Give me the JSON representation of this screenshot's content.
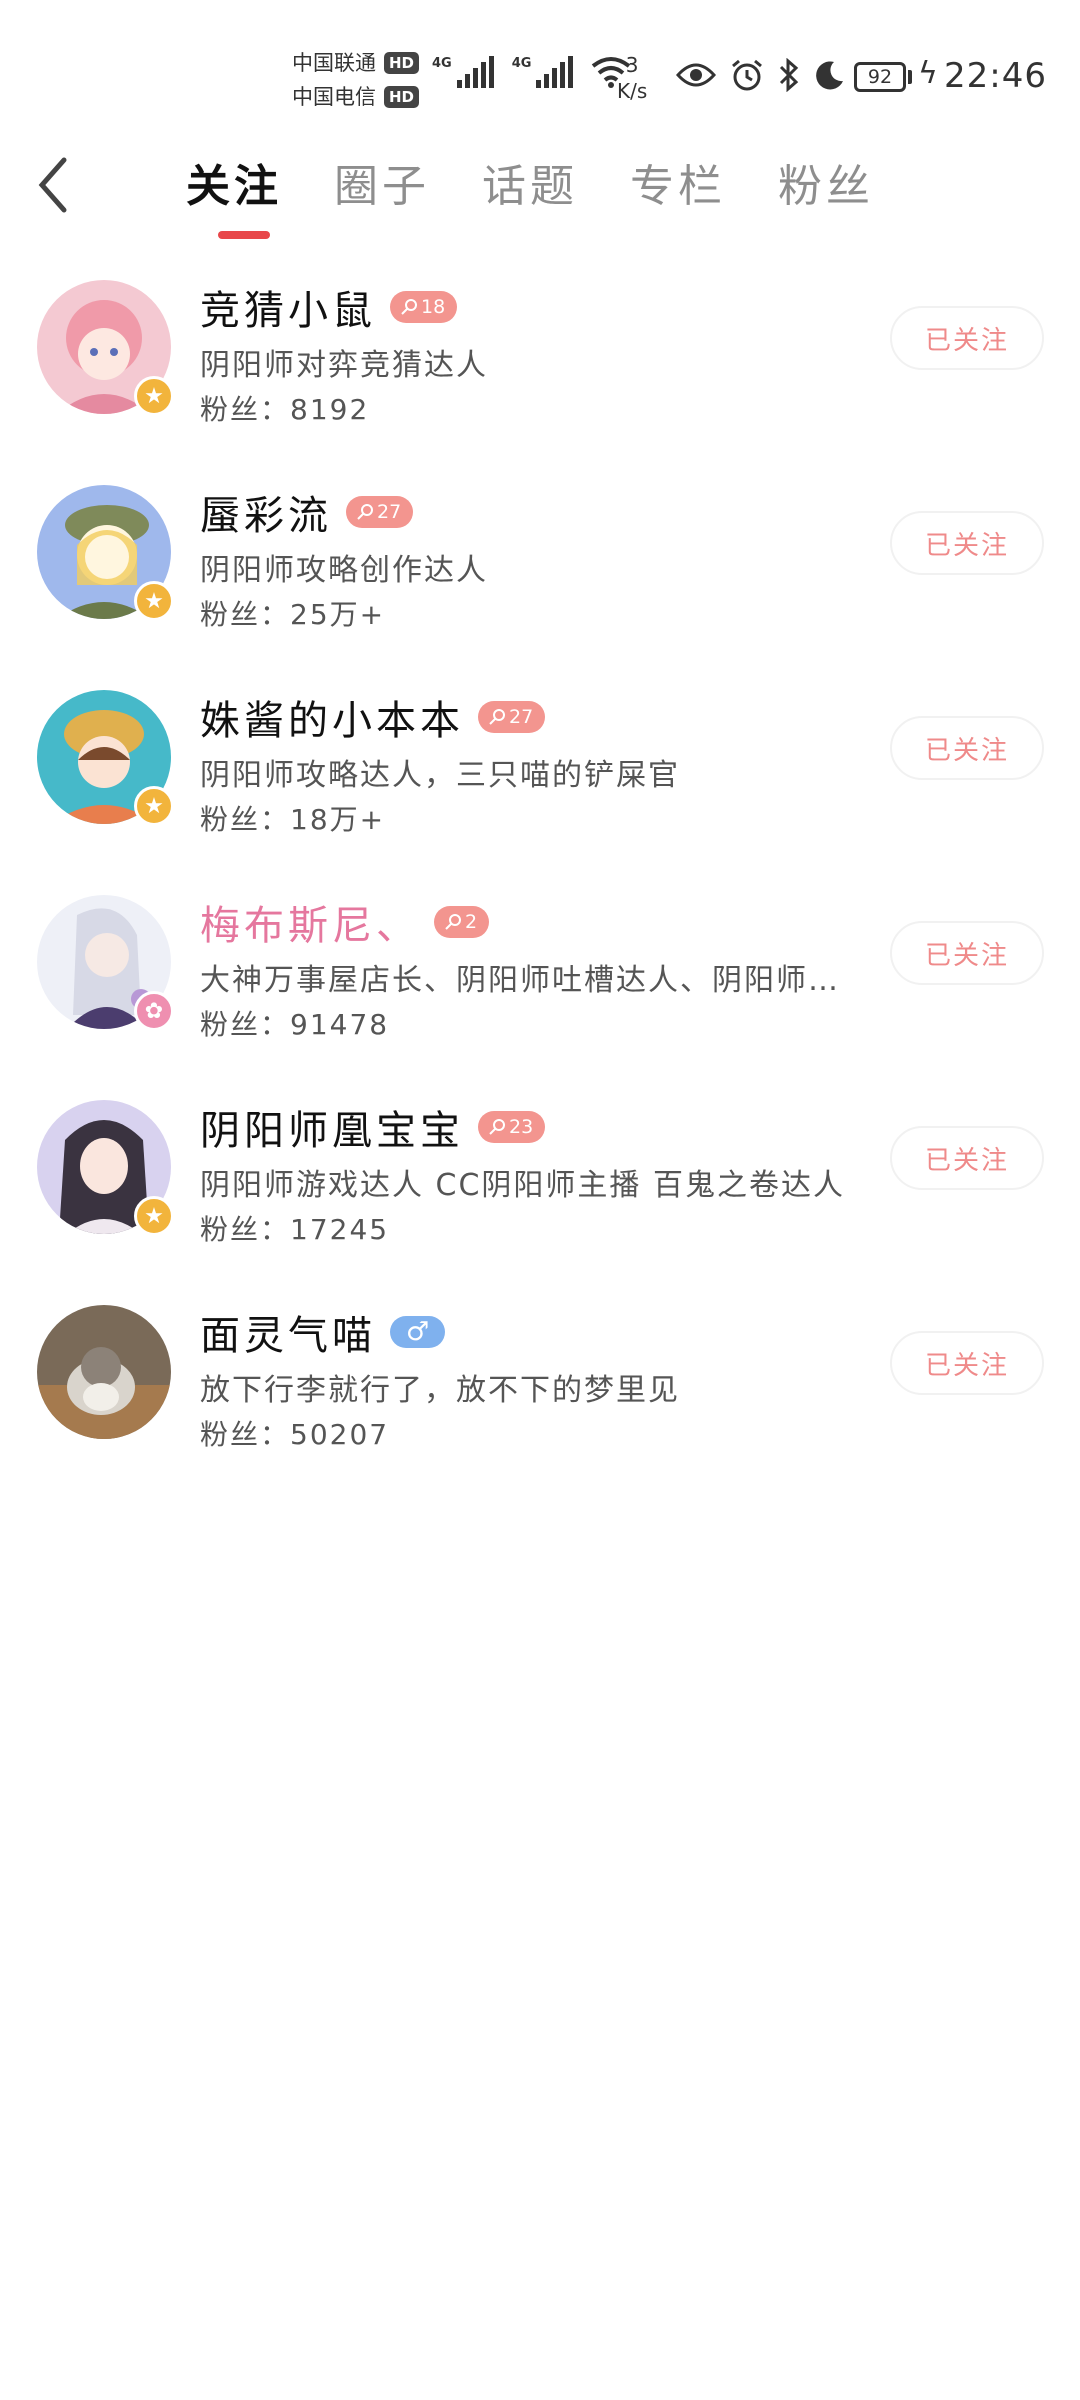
{
  "status_bar": {
    "carrier1": "中国联通",
    "carrier2": "中国电信",
    "hd": "HD",
    "net_type": "4G",
    "speed_value": "3",
    "speed_unit": "K/s",
    "battery": "92",
    "time": "22:46",
    "icons": [
      "eye-icon",
      "alarm-icon",
      "bluetooth-icon",
      "moon-icon"
    ]
  },
  "header": {
    "back_icon": "chevron-left-icon",
    "tabs": [
      {
        "label": "关注",
        "active": true
      },
      {
        "label": "圈子",
        "active": false
      },
      {
        "label": "话题",
        "active": false
      },
      {
        "label": "专栏",
        "active": false
      },
      {
        "label": "粉丝",
        "active": false
      }
    ],
    "accent_color": "#e8474a"
  },
  "users": [
    {
      "name": "竞猜小鼠",
      "level": "18",
      "desc": "阴阳师对弈竞猜达人",
      "fans": "粉丝：8192",
      "button": "已关注"
    },
    {
      "name": "蜃彩流",
      "level": "27",
      "desc": "阴阳师攻略创作达人",
      "fans": "粉丝：25万+",
      "button": "已关注"
    },
    {
      "name": "姝酱的小本本",
      "level": "27",
      "desc": "阴阳师攻略达人，三只喵的铲屎官",
      "fans": "粉丝：18万+",
      "button": "已关注"
    },
    {
      "name": "梅布斯尼、",
      "level": "2",
      "desc": "大神万事屋店长、阴阳师吐槽达人、阴阳师…",
      "fans": "粉丝：91478",
      "button": "已关注"
    },
    {
      "name": "阴阳师凰宝宝",
      "level": "23",
      "desc": "阴阳师游戏达人 CC阴阳师主播 百鬼之卷达人",
      "fans": "粉丝：17245",
      "button": "已关注"
    },
    {
      "name": "面灵气喵",
      "gender": "♂",
      "desc": "放下行李就行了，放不下的梦里见",
      "fans": "粉丝：50207",
      "button": "已关注"
    }
  ]
}
